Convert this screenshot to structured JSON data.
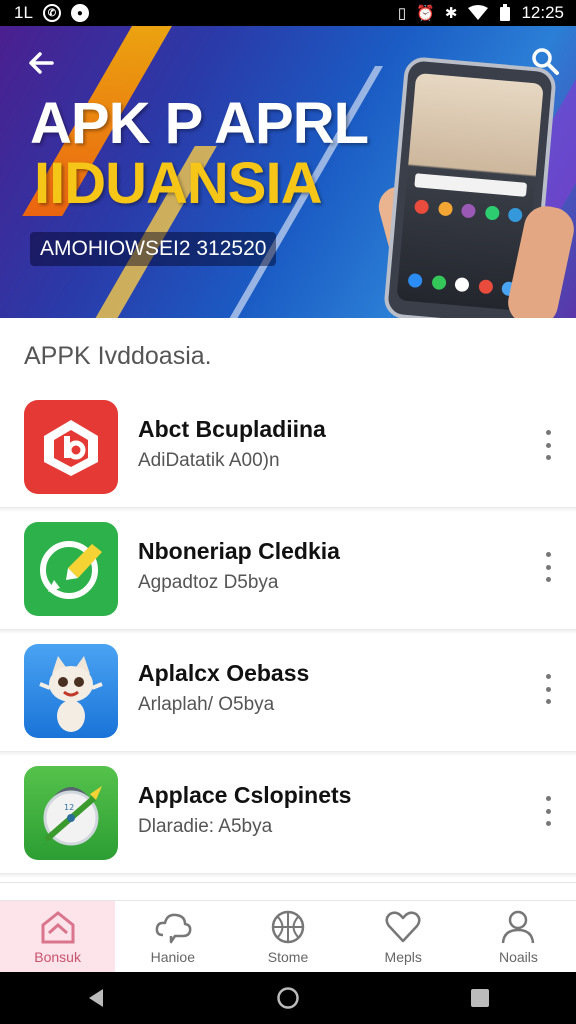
{
  "status_bar": {
    "left_text": "1L",
    "time": "12:25",
    "icons": [
      "whatsapp-icon",
      "app-notification-icon",
      "vibrate-icon",
      "alarm-icon",
      "bluetooth-icon",
      "wifi-icon",
      "battery-icon"
    ]
  },
  "banner": {
    "title": "APK P APRL",
    "subtitle": "IIDUANSIA",
    "code": "AMOHIOWSEI2 312520",
    "colors": {
      "title": "#ffffff",
      "subtitle": "#f5c518"
    }
  },
  "section": {
    "title": "APPK Ivddoasia."
  },
  "apps": [
    {
      "name": "Abct Bcupladiina",
      "meta": "AdiDatatik A00)n",
      "icon": "red-app-icon"
    },
    {
      "name": "Nboneriap Cledkia",
      "meta": "Agpadtoz D5bya",
      "icon": "green-chat-icon"
    },
    {
      "name": "Aplalcx Oebass",
      "meta": "Arlaplah/ O5bya",
      "icon": "cartoon-cat-icon"
    },
    {
      "name": "Applace Cslopinets",
      "meta": "Dlaradie: A5bya",
      "icon": "compass-icon"
    }
  ],
  "bottom_nav": [
    {
      "label": "Bonsuk",
      "icon": "home-icon",
      "active": true
    },
    {
      "label": "Hanioe",
      "icon": "cloud-icon",
      "active": false
    },
    {
      "label": "Stome",
      "icon": "basketball-icon",
      "active": false
    },
    {
      "label": "Mepls",
      "icon": "heart-icon",
      "active": false
    },
    {
      "label": "Noails",
      "icon": "person-icon",
      "active": false
    }
  ]
}
